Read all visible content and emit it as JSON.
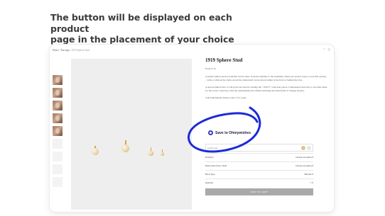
{
  "headline": {
    "line1": "The button will be displayed on each product",
    "line2": "page in the placement of your choice"
  },
  "breadcrumb": {
    "home": "Home",
    "sep1": " / ",
    "section": "Earrings",
    "sep2": " / ",
    "current": "1919 Sphere Stud"
  },
  "top_icons": [
    "heart-icon",
    "bag-icon"
  ],
  "product": {
    "title": "1919 Sphere Stud",
    "price_label": "From ",
    "price_value": "£170",
    "description": [
      "A perfect sphere stud is available in four sizes, from the smallest to the statement. There are several ways to wear this earring – with or without the chain. Avoid the chain itself can be placed either at the front or behind the lobe.",
      "A special-fluted view of 14k gold was used in creating the \"1919 F\" collection pieces. Understated and bold, it can tailor made for the iconic collection, with the requirements the refined texturing and letterforms of vintage jewelry.",
      "Sold individually. Please order 2 for a pair."
    ]
  },
  "ohmywishes_button": {
    "label": "Save to Ohmywishes",
    "icon": "ohmywishes-logo-icon",
    "color": "#3d39c4"
  },
  "options": {
    "color_label": "Gold Color",
    "swatches": [
      "#d9c48e",
      "#e6e6e6"
    ],
    "rows": [
      {
        "label": "Diameter",
        "value": "Choose an option"
      },
      {
        "label": "Removable Drop Chain",
        "value": "Choose an option"
      },
      {
        "label": "Back Type",
        "value": "Silicone"
      },
      {
        "label": "Quantity",
        "value": "1"
      }
    ],
    "add_to_cart": "ADD TO CART"
  },
  "thumbnails": 9,
  "annotation": {
    "circle_color": "#1c2bd9"
  }
}
